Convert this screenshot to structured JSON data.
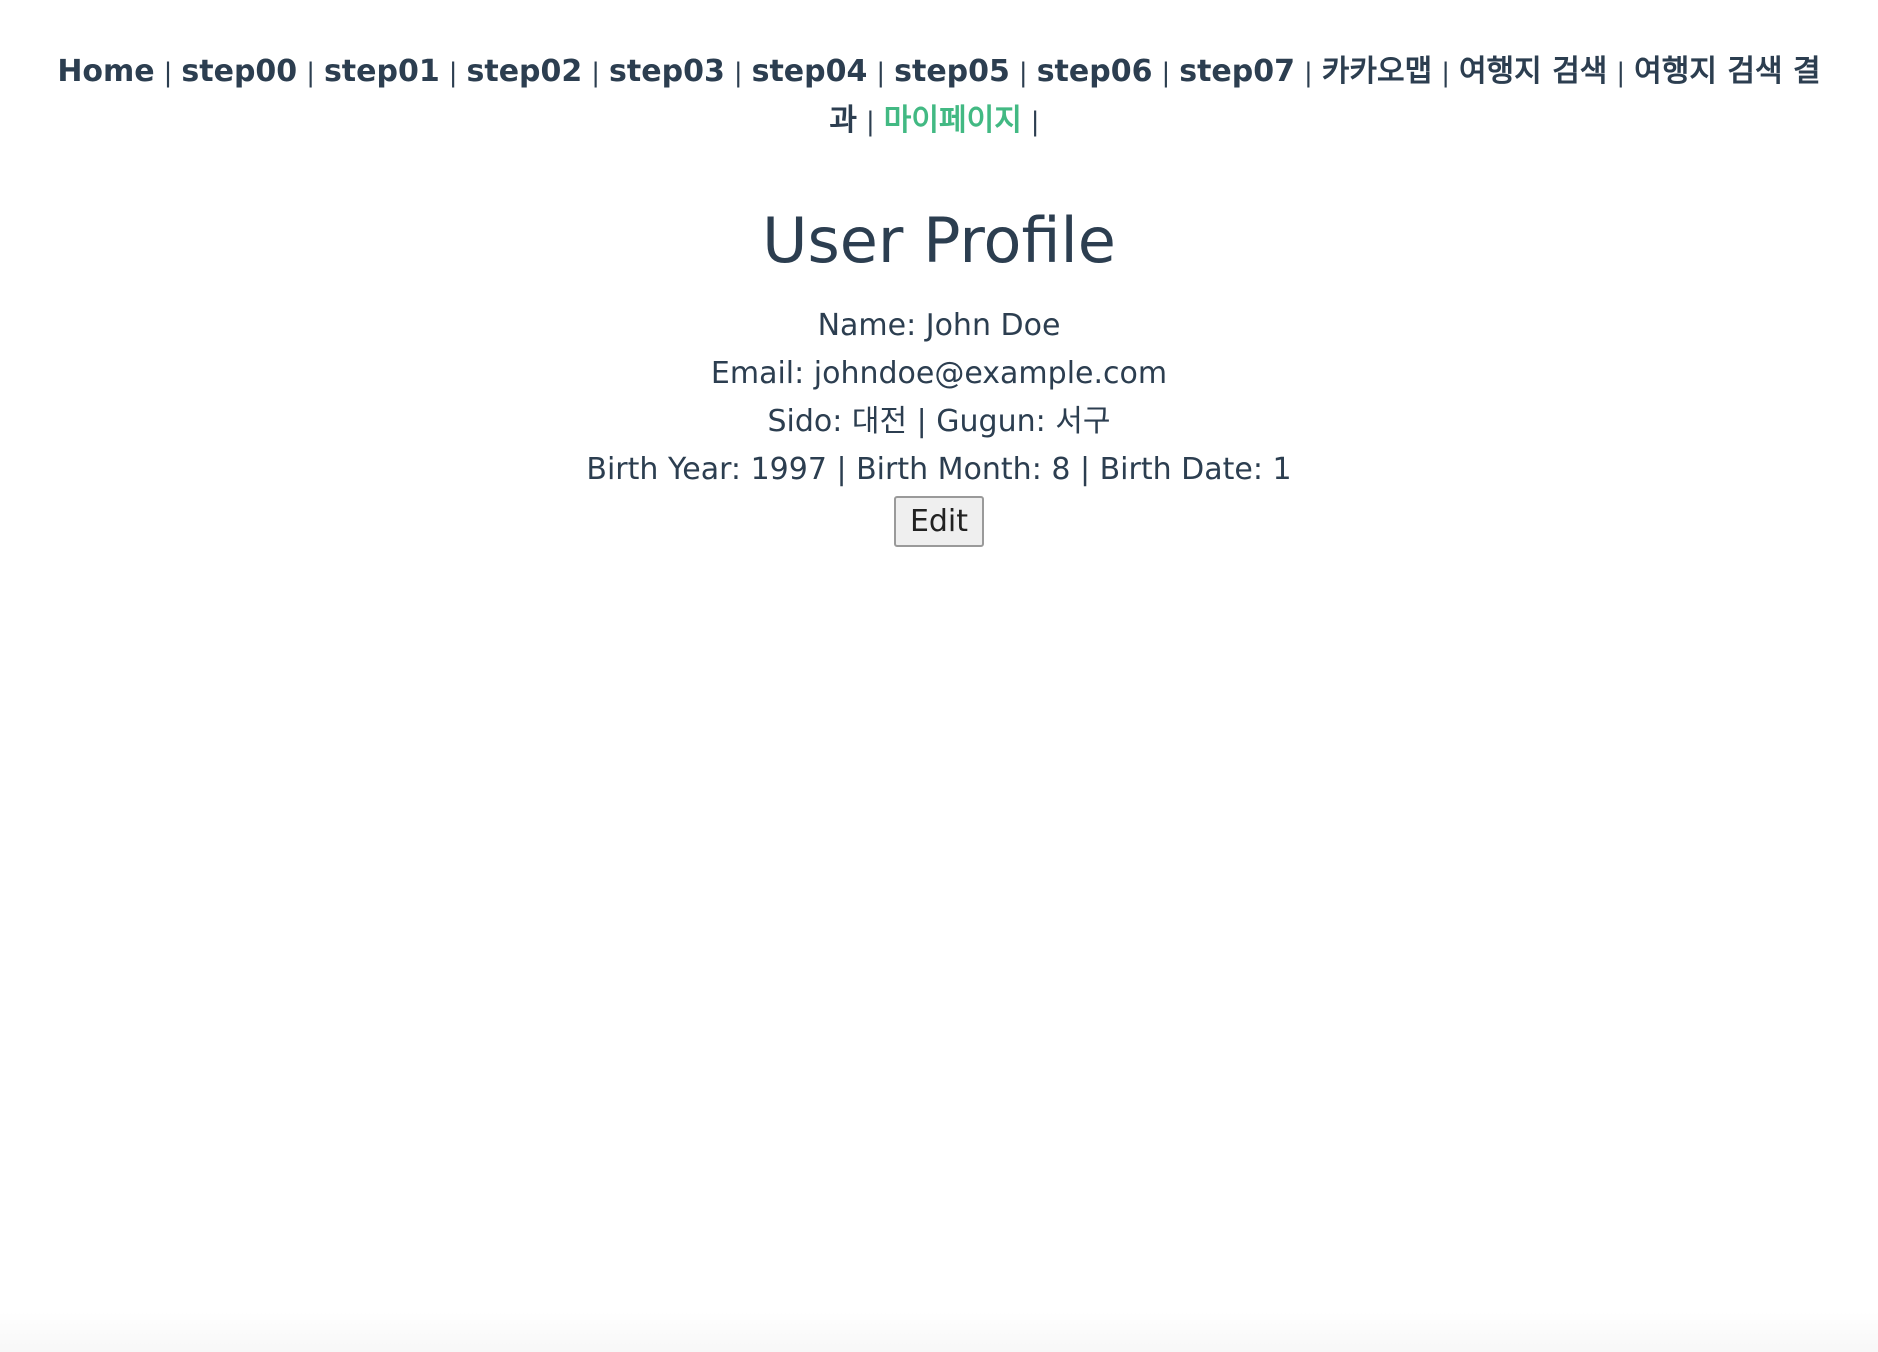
{
  "nav": {
    "separator": "|",
    "items": [
      {
        "label": "Home",
        "active": false
      },
      {
        "label": "step00",
        "active": false
      },
      {
        "label": "step01",
        "active": false
      },
      {
        "label": "step02",
        "active": false
      },
      {
        "label": "step03",
        "active": false
      },
      {
        "label": "step04",
        "active": false
      },
      {
        "label": "step05",
        "active": false
      },
      {
        "label": "step06",
        "active": false
      },
      {
        "label": "step07",
        "active": false
      },
      {
        "label": "카카오맵",
        "active": false
      },
      {
        "label": "여행지 검색",
        "active": false
      },
      {
        "label": "여행지 검색 결과",
        "active": false
      },
      {
        "label": "마이페이지",
        "active": true
      }
    ]
  },
  "profile": {
    "title": "User Profile",
    "name_line": "Name: John Doe",
    "email_line": "Email: johndoe@example.com",
    "region_line": "Sido: 대전 | Gugun: 서구",
    "birth_line": "Birth Year: 1997 | Birth Month: 8 | Birth Date: 1",
    "edit_label": "Edit"
  },
  "colors": {
    "text": "#2c3e50",
    "active_link": "#42b983"
  }
}
